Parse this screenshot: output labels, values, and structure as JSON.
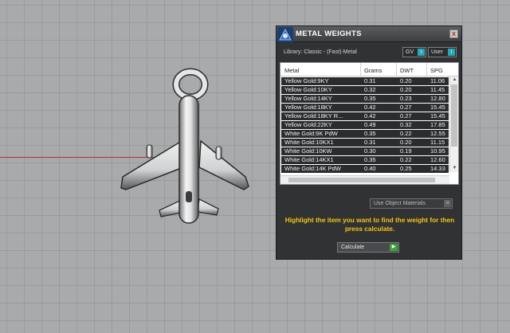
{
  "panel": {
    "title": "METAL WEIGHTS",
    "close_label": "x",
    "library": "Library: Classic - (Fast)-Metal",
    "unit_buttons": [
      {
        "label": "GV",
        "badge": "i"
      },
      {
        "label": "User",
        "badge": "i"
      }
    ],
    "table": {
      "headers": [
        "Metal",
        "Grams",
        "DWT",
        "SPG"
      ],
      "rows": [
        {
          "metal": "Yellow Gold:9KY",
          "grams": "0.31",
          "dwt": "0.20",
          "spg": "11.06"
        },
        {
          "metal": "Yellow Gold:10KY",
          "grams": "0.32",
          "dwt": "0.20",
          "spg": "11.45"
        },
        {
          "metal": "Yellow Gold:14KY",
          "grams": "0.35",
          "dwt": "0.23",
          "spg": "12.80"
        },
        {
          "metal": "Yellow Gold:18KY",
          "grams": "0.42",
          "dwt": "0.27",
          "spg": "15.45"
        },
        {
          "metal": "Yellow Gold:18KY R...",
          "grams": "0.42",
          "dwt": "0.27",
          "spg": "15.45"
        },
        {
          "metal": "Yellow Gold:22KY",
          "grams": "0.49",
          "dwt": "0.32",
          "spg": "17.85"
        },
        {
          "metal": "White Gold:9K PdW",
          "grams": "0.35",
          "dwt": "0.22",
          "spg": "12.55"
        },
        {
          "metal": "White Gold:10KX1",
          "grams": "0.31",
          "dwt": "0.20",
          "spg": "11.15"
        },
        {
          "metal": "White Gold:10KW",
          "grams": "0.30",
          "dwt": "0.19",
          "spg": "10.95"
        },
        {
          "metal": "White Gold:14KX1",
          "grams": "0.35",
          "dwt": "0.22",
          "spg": "12.60"
        },
        {
          "metal": "White Gold:14K PdW",
          "grams": "0.40",
          "dwt": "0.25",
          "spg": "14.33"
        }
      ]
    },
    "use_object_materials": "Use Object Materials",
    "use_object_toggle": "o",
    "instruction": "Highlight the item you want to find the weight for then press calculate.",
    "calculate_label": "Calculate",
    "calculate_icon": "▶"
  },
  "colors": {
    "viewport_bg": "#a9aaac",
    "panel_bg": "#303233",
    "row_bg": "#2b2c2e",
    "instruction_text": "#f5c516",
    "accent_cyan": "#29a6b8",
    "go_green": "#3fa33c",
    "axis_red": "#b5322f"
  },
  "icons": {
    "logo": "rhino-app-icon",
    "close": "close-icon",
    "scroll_up": "arrow-up-icon",
    "scroll_down": "arrow-down-icon",
    "go": "play-arrow-icon"
  }
}
